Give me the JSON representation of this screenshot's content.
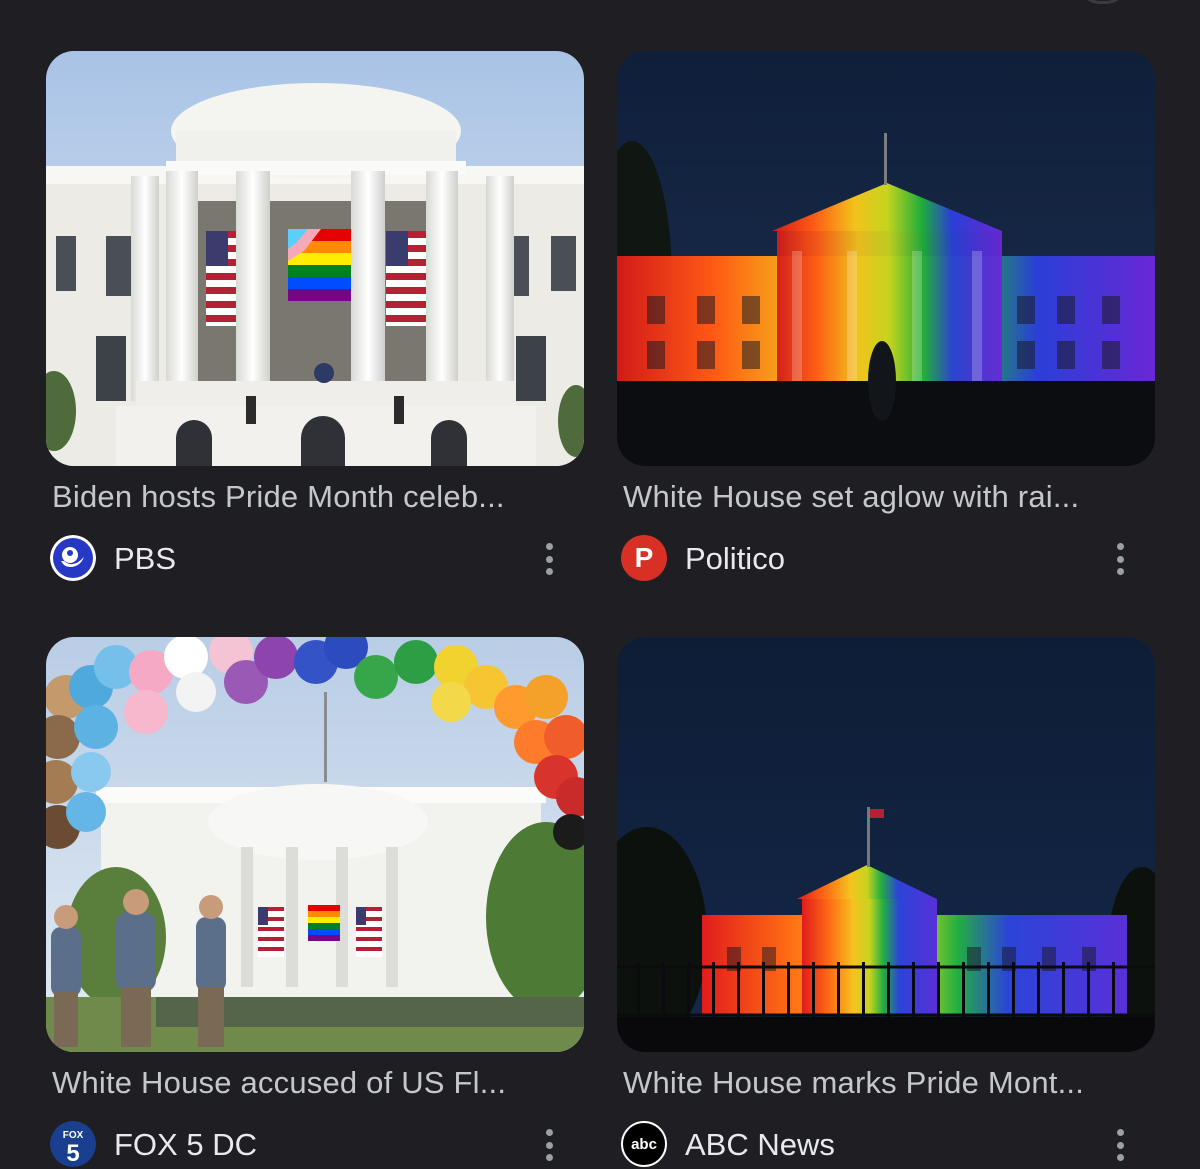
{
  "results": [
    {
      "title": "Biden hosts Pride Month celeb...",
      "source": "PBS",
      "favicon": "pbs-icon",
      "image": "white-house-pride-flag-photo"
    },
    {
      "title": "White House set aglow with rai...",
      "source": "Politico",
      "favicon": "politico-icon",
      "favicon_letter": "P",
      "image": "white-house-rainbow-lights-photo"
    },
    {
      "title": "White House accused of US Fl...",
      "source": "FOX 5 DC",
      "favicon": "fox5-icon",
      "image": "white-house-balloon-arch-photo"
    },
    {
      "title": "White House marks Pride Mont...",
      "source": "ABC News",
      "favicon": "abc-icon",
      "favicon_text": "abc",
      "image": "white-house-rainbow-night-photo"
    }
  ],
  "colors": {
    "background": "#1f1f23",
    "title_text": "#c4c7cc",
    "source_text": "#e8eaed",
    "politico_red": "#d93025",
    "pbs_blue": "#2638c4"
  }
}
